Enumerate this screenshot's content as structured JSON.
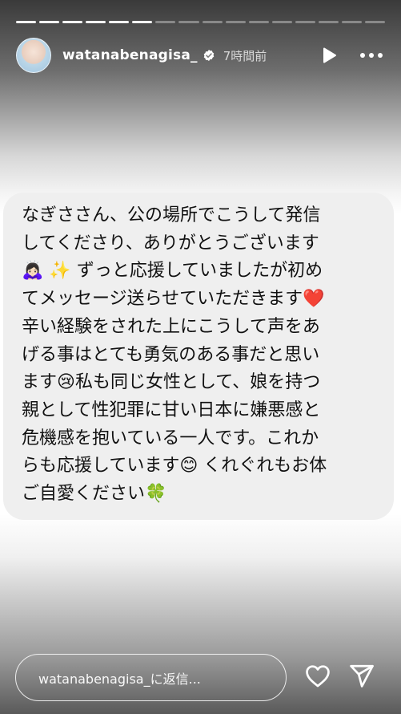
{
  "story": {
    "segments_total": 16,
    "segments_viewed": 6
  },
  "header": {
    "username": "watanabenagisa_",
    "time_ago": "7時間前",
    "icons": {
      "verified": "verified-badge-icon",
      "play": "play-icon",
      "more": "more-options-icon"
    }
  },
  "message": {
    "line1": "なぎささん、公の場所でこうして発信",
    "line2": "してくださり、ありがとうございます",
    "line3_emoji_a": "🙇🏻‍♀️",
    "line3_emoji_b": "✨",
    "line3_text": "ずっと応援していましたが初め",
    "line4_text": "てメッセージ送らせていただきます",
    "line4_emoji": "❤️",
    "line5": "辛い経験をされた上にこうして声をあ",
    "line6": "げる事はとても勇気のある事だと思い",
    "line7_text_a": "ます",
    "line7_emoji": "😢",
    "line7_text_b": "私も同じ女性として、娘を持つ",
    "line8": "親として性犯罪に甘い日本に嫌悪感と",
    "line9": "危機感を抱いている一人です。これか",
    "line10_text_a": "らも応援しています",
    "line10_emoji": "😊",
    "line10_text_b": "くれぐれもお体",
    "line11_text": "ご自愛ください",
    "line11_emoji": "🍀"
  },
  "footer": {
    "reply_placeholder": "watanabenagisa_に返信...",
    "icons": {
      "like": "heart-icon",
      "share": "send-icon"
    }
  }
}
